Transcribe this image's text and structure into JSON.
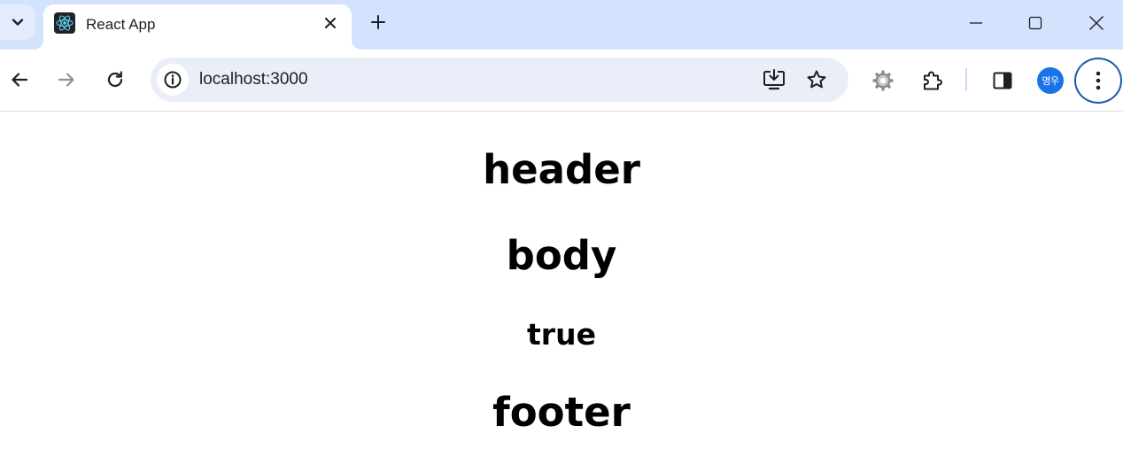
{
  "browser": {
    "tab": {
      "title": "React App",
      "favicon": "react-logo-icon"
    },
    "address_bar": {
      "url": "localhost:3000"
    },
    "profile": {
      "initials": "명우",
      "color": "#1a73e8"
    },
    "colors": {
      "tabstrip": "#d3e3fd",
      "omnibox": "#e9eef8",
      "menu_ring": "#1f57b3"
    },
    "icons": {
      "tab_search": "chevron-down-icon",
      "tab_close": "close-icon",
      "new_tab": "plus-icon",
      "minimize": "minimize-icon",
      "maximize": "maximize-icon",
      "close_window": "close-icon",
      "back": "arrow-left-icon",
      "forward": "arrow-right-icon",
      "reload": "reload-icon",
      "site_info": "info-icon",
      "install": "install-app-icon",
      "bookmark": "star-icon",
      "extension_settings": "gear-icon",
      "extensions": "puzzle-icon",
      "side_panel": "side-panel-icon",
      "menu": "more-vertical-icon"
    }
  },
  "page": {
    "header": "header",
    "body": "body",
    "flag": "true",
    "footer": "footer"
  }
}
